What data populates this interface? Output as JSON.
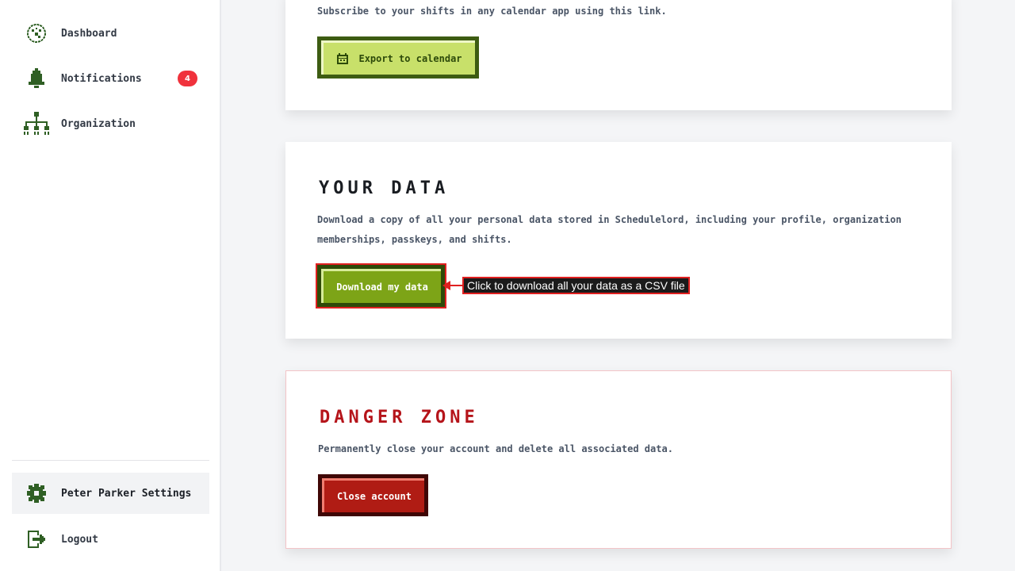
{
  "sidebar": {
    "items": [
      {
        "label": "Dashboard",
        "icon": "dashboard-icon"
      },
      {
        "label": "Notifications",
        "icon": "bell-icon",
        "badge": "4"
      },
      {
        "label": "Organization",
        "icon": "org-chart-icon"
      }
    ],
    "bottom": [
      {
        "label": "Peter Parker Settings",
        "icon": "gear-icon",
        "active": true
      },
      {
        "label": "Logout",
        "icon": "logout-icon"
      }
    ]
  },
  "calendar": {
    "description": "Subscribe to your shifts in any calendar app using this link.",
    "button_label": "Export to calendar"
  },
  "your_data": {
    "title": "YOUR DATA",
    "description": "Download a copy of all your personal data stored in Schedulelord, including your profile, organization memberships, passkeys, and shifts.",
    "button_label": "Download my data",
    "annotation": "Click to download all your data as a CSV file"
  },
  "danger": {
    "title": "DANGER ZONE",
    "description": "Permanently close your account and delete all associated data.",
    "button_label": "Close account"
  },
  "colors": {
    "brand_green": "#2f5f24",
    "button_lime": "#c8e06a",
    "button_green": "#7da417",
    "danger_red": "#b5141a",
    "badge_red": "#f0323c",
    "annotation_red": "#e02020"
  }
}
